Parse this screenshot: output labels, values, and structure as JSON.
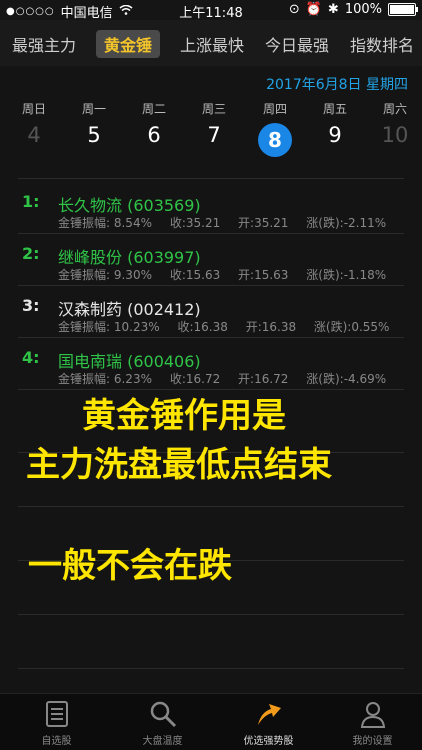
{
  "status": {
    "carrier": "中国电信",
    "time": "上午11:48",
    "battery": "100%"
  },
  "tabs": [
    {
      "label": "最强主力",
      "active": false
    },
    {
      "label": "黄金锤",
      "active": true
    },
    {
      "label": "上涨最快",
      "active": false
    },
    {
      "label": "今日最强",
      "active": false
    },
    {
      "label": "指数排名",
      "active": false
    }
  ],
  "date": "2017年6月8日 星期四",
  "week": [
    {
      "wd": "周日",
      "num": "4",
      "dim": true
    },
    {
      "wd": "周一",
      "num": "5",
      "dim": false
    },
    {
      "wd": "周二",
      "num": "6",
      "dim": false
    },
    {
      "wd": "周三",
      "num": "7",
      "dim": false
    },
    {
      "wd": "周四",
      "num": "8",
      "selected": true
    },
    {
      "wd": "周五",
      "num": "9",
      "dim": false
    },
    {
      "wd": "周六",
      "num": "10",
      "dim": true
    }
  ],
  "stocks": [
    {
      "rank": "1:",
      "name": "长久物流 (603569)",
      "amp": "金锤振幅: 8.54%",
      "close": "收:35.21",
      "open": "开:35.21",
      "chg": "涨(跌):-2.11%",
      "color": "green"
    },
    {
      "rank": "2:",
      "name": "继峰股份 (603997)",
      "amp": "金锤振幅: 9.30%",
      "close": "收:15.63",
      "open": "开:15.63",
      "chg": "涨(跌):-1.18%",
      "color": "green"
    },
    {
      "rank": "3:",
      "name": "汉森制药 (002412)",
      "amp": "金锤振幅: 10.23%",
      "close": "收:16.38",
      "open": "开:16.38",
      "chg": "涨(跌):0.55%",
      "color": "white"
    },
    {
      "rank": "4:",
      "name": "国电南瑞 (600406)",
      "amp": "金锤振幅: 6.23%",
      "close": "收:16.72",
      "open": "开:16.72",
      "chg": "涨(跌):-4.69%",
      "color": "green"
    }
  ],
  "captions": {
    "line1": "黄金锤作用是",
    "line2": "主力洗盘最低点结束",
    "line3": "一般不会在跌"
  },
  "nav": [
    {
      "label": "自选股",
      "icon": "list-icon"
    },
    {
      "label": "大盘温度",
      "icon": "search-icon"
    },
    {
      "label": "优选强势股",
      "icon": "trend-arrow-icon",
      "active": true
    },
    {
      "label": "我的设置",
      "icon": "person-icon"
    }
  ]
}
